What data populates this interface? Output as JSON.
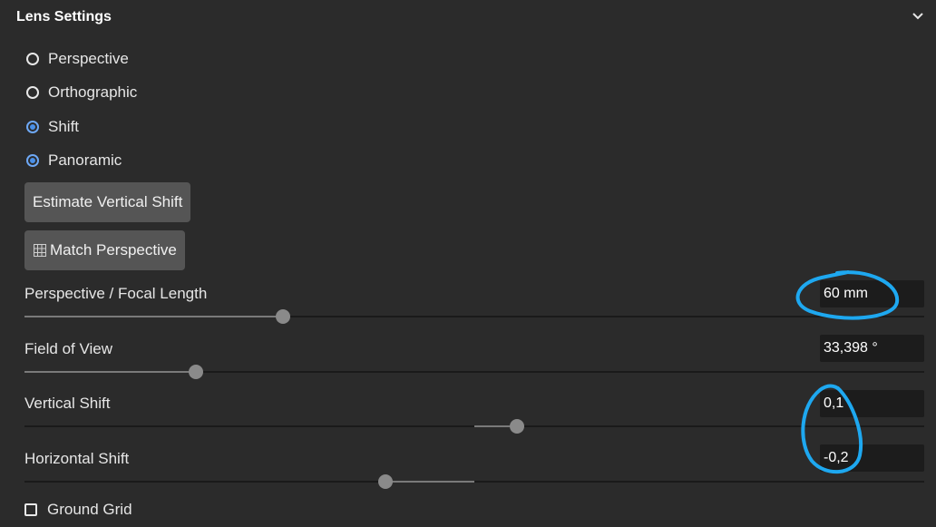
{
  "header": {
    "title": "Lens Settings",
    "collapse_icon": "chevron-down-icon"
  },
  "projection": {
    "options": [
      {
        "label": "Perspective",
        "checked": false
      },
      {
        "label": "Orthographic",
        "checked": false
      },
      {
        "label": "Shift",
        "checked": true
      },
      {
        "label": "Panoramic",
        "checked": true
      }
    ]
  },
  "buttons": {
    "estimate_vertical_shift": "Estimate Vertical Shift",
    "match_perspective": "Match Perspective",
    "match_perspective_icon": "perspective-grid-icon"
  },
  "params": {
    "focal_length": {
      "label": "Perspective / Focal Length",
      "value": "60 mm",
      "slider": 0.287
    },
    "field_of_view": {
      "label": "Field of View",
      "value": "33,398 °",
      "slider": 0.191
    },
    "vertical_shift": {
      "label": "Vertical Shift",
      "value": "0,1",
      "slider": 0.547,
      "origin": 0.5
    },
    "horizontal_shift": {
      "label": "Horizontal Shift",
      "value": "-0,2",
      "slider": 0.401,
      "origin": 0.5
    }
  },
  "ground_grid": {
    "label": "Ground Grid",
    "checked": false
  },
  "colors": {
    "background": "#2b2b2b",
    "accent": "#4a90e8",
    "annotation": "#1ea8f0"
  }
}
